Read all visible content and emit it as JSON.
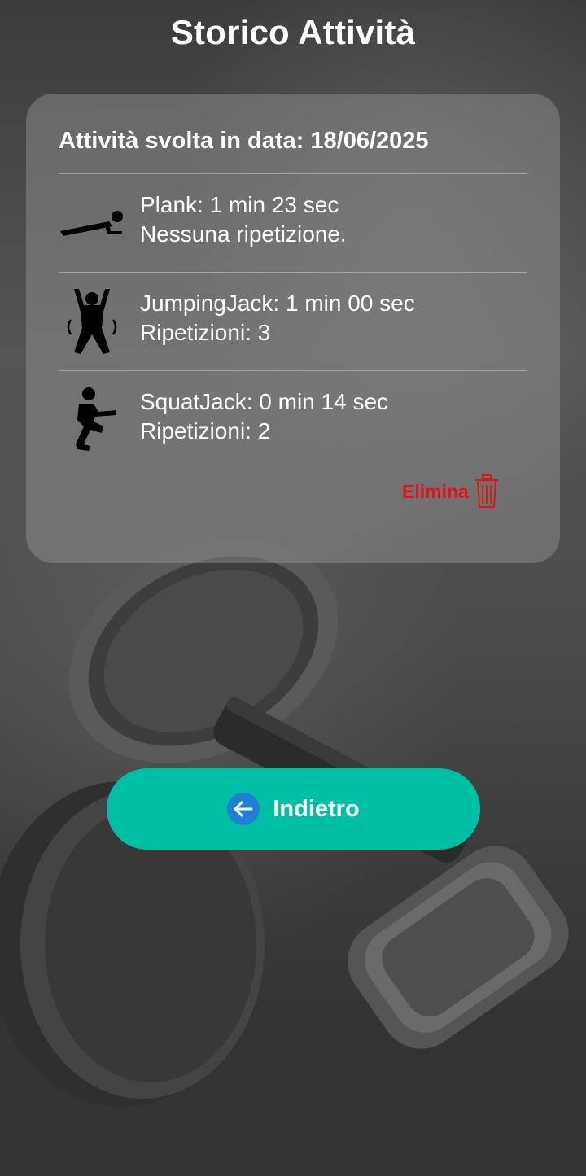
{
  "header": {
    "title": "Storico Attività"
  },
  "card": {
    "date_label": "Attività svolta in data: 18/06/2025",
    "activities": [
      {
        "icon": "plank-icon",
        "line1": "Plank: 1 min 23 sec",
        "line2": "Nessuna ripetizione."
      },
      {
        "icon": "jumping-jack-icon",
        "line1": "JumpingJack: 1 min 00 sec",
        "line2": "Ripetizioni: 3"
      },
      {
        "icon": "squat-jack-icon",
        "line1": "SquatJack: 0 min 14 sec",
        "line2": "Ripetizioni: 2"
      }
    ],
    "delete_label": "Elimina"
  },
  "footer": {
    "back_label": "Indietro"
  },
  "colors": {
    "accent": "#00bfa5",
    "delete": "#e01414",
    "back_icon": "#1e7fd4"
  }
}
